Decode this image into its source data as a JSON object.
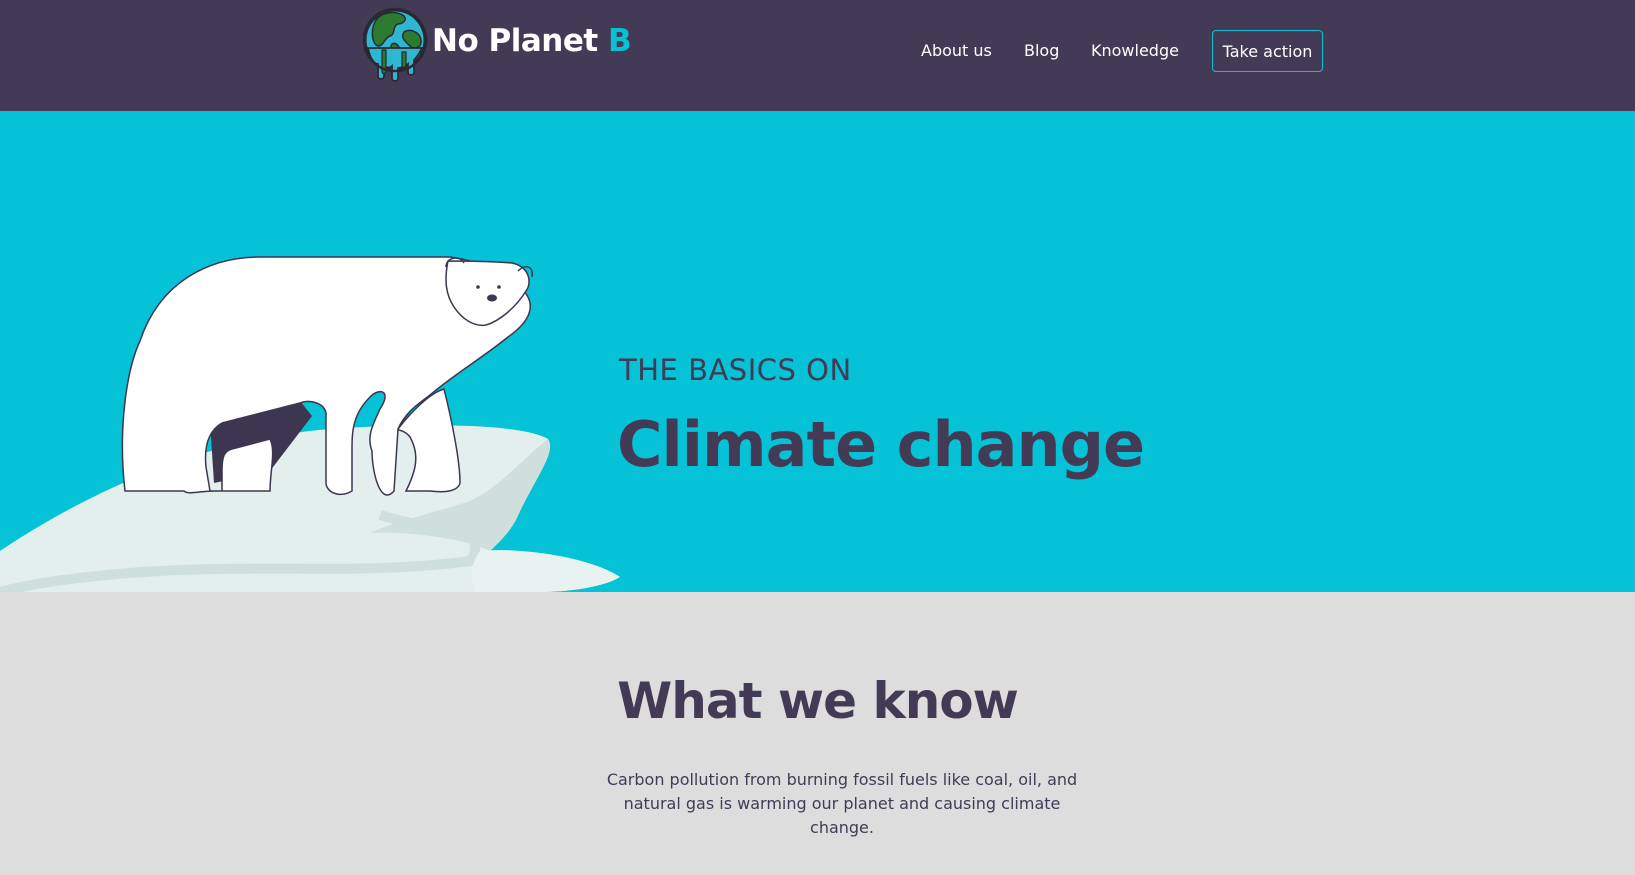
{
  "header": {
    "logo": {
      "name_main": "No Planet",
      "name_accent": "B",
      "icon": "melting-globe-icon"
    },
    "nav": {
      "about_label": "About us",
      "blog_label": "Blog",
      "knowledge_label": "Knowledge",
      "cta_label": "Take action"
    }
  },
  "hero": {
    "kicker": "THE BASICS ON",
    "title": "Climate change",
    "illustration": "polar-bear-on-ice-floe"
  },
  "know": {
    "title": "What we know",
    "body": "Carbon pollution from burning fossil fuels like coal, oil, and natural gas is warming our planet and causing climate change."
  },
  "colors": {
    "header_bg": "#433b55",
    "accent": "#08c1d5",
    "hero_bg": "#05c2d6",
    "section_bg": "#dddddd",
    "text_dark": "#433b55",
    "ice": "#e3efec"
  }
}
